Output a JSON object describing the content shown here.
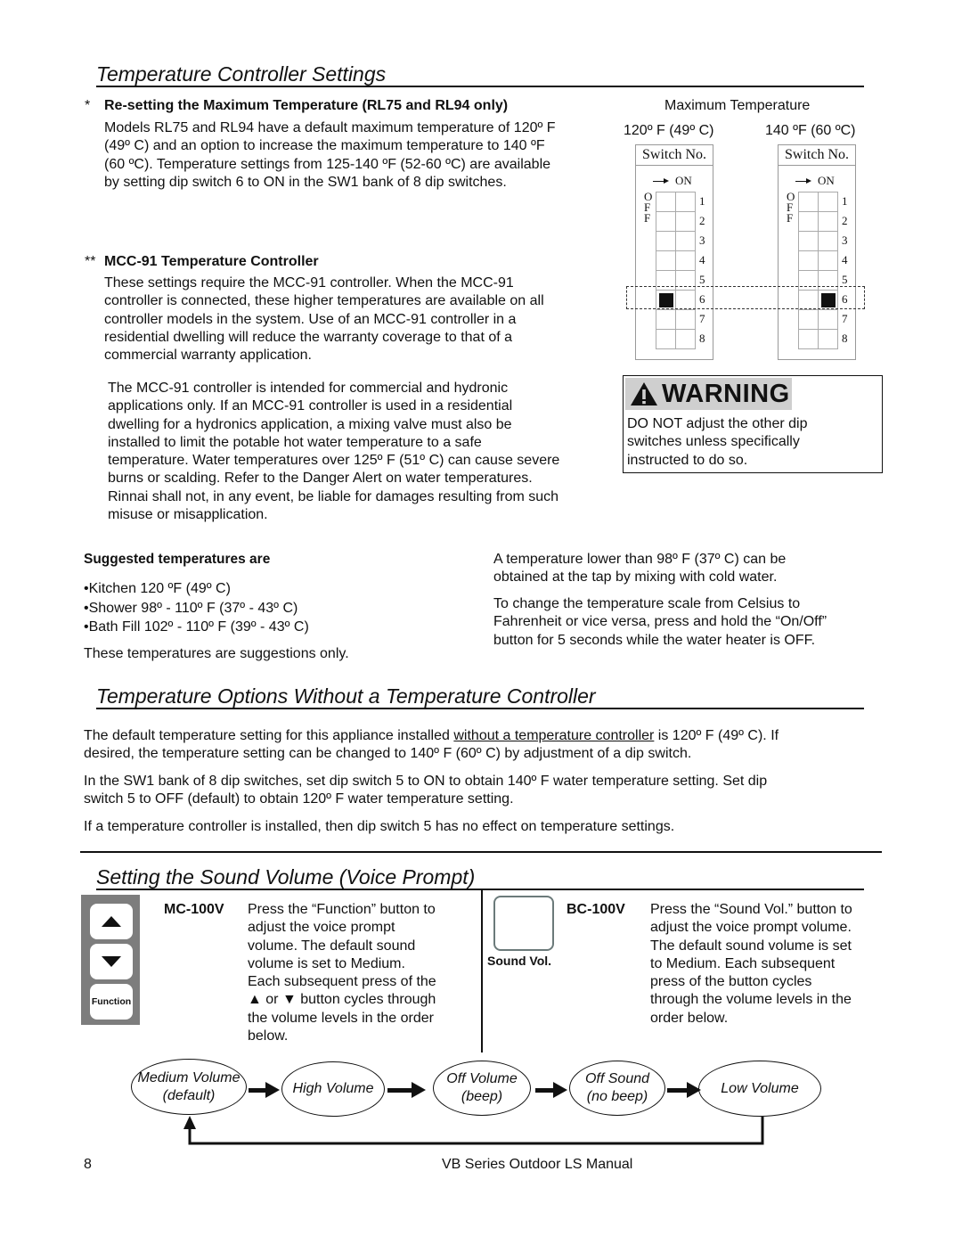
{
  "sections": {
    "controller_settings": {
      "title": "Temperature Controller Settings",
      "reset": {
        "marker": "*",
        "heading": "Re-setting the Maximum Temperature (RL75 and RL94 only)",
        "lines": [
          "Models RL75 and RL94 have a default maximum temperature of 120º F",
          "(49º C) and an option to increase the maximum temperature to 140 ºF",
          "(60 ºC).  Temperature settings from 125-140 ºF (52-60 ºC) are available",
          "by setting dip switch 6 to ON in the SW1 bank of 8 dip switches."
        ]
      },
      "mcc91": {
        "marker": "**",
        "heading": "MCC-91 Temperature Controller",
        "lines": [
          "These settings require the MCC-91 controller.  When the MCC-91",
          "controller is connected, these higher temperatures are available on all",
          "controller models in the system. Use of an MCC-91 controller in a",
          "residential dwelling will reduce the warranty coverage to that of a",
          "commercial warranty application."
        ],
        "note_lines": [
          "The MCC-91 controller is intended for commercial and hydronic",
          "applications only. If an MCC-91 controller is used in a residential",
          "dwelling for a hydronics application, a mixing valve must also be",
          "installed to limit the potable hot water temperature to a safe",
          "temperature. Water temperatures over 125º F (51º C) can cause severe",
          "burns or scalding. Refer to the Danger Alert on water temperatures.",
          "Rinnai shall not, in any event, be liable for damages resulting from such",
          "misuse or misapplication."
        ]
      },
      "dip_diagram": {
        "title": "Maximum Temperature",
        "panels": [
          {
            "temp": "120º F (49º C)",
            "header": "Switch No.",
            "on_label": "ON",
            "off_label": [
              "O",
              "F",
              "F"
            ],
            "switch6_state": "OFF"
          },
          {
            "temp": "140 ºF (60 ºC)",
            "header": "Switch No.",
            "on_label": "ON",
            "off_label": [
              "O",
              "F",
              "F"
            ],
            "switch6_state": "ON"
          }
        ],
        "switch_numbers": [
          "1",
          "2",
          "3",
          "4",
          "5",
          "6",
          "7",
          "8"
        ]
      },
      "warning": {
        "icon": "warning-triangle-icon",
        "title": "WARNING",
        "lines": [
          "DO NOT adjust the other dip",
          "switches unless specifically",
          "instructed to do so."
        ]
      },
      "suggested": {
        "heading": "Suggested temperatures are",
        "items": [
          "•Kitchen  120 ºF (49º C)",
          "•Shower  98º - 110º F (37º - 43º C)",
          "•Bath Fill 102º - 110º F (39º - 43º C)"
        ],
        "footer": "These temperatures are suggestions only."
      },
      "right_notes": {
        "p1": [
          "A temperature lower than 98º F (37º C) can be",
          "obtained at the tap by mixing with cold water."
        ],
        "p2": [
          "To change the temperature scale from Celsius to",
          "Fahrenheit or vice versa, press and hold the “On/Off”",
          "button for 5 seconds while the water heater is OFF."
        ]
      }
    },
    "no_controller": {
      "title": "Temperature Options Without a Temperature Controller",
      "p1_pre": "The default temperature setting for this appliance installed ",
      "p1_link": "without a temperature controller",
      "p1_post": " is 120º F (49º C).  If",
      "p1_line2": "desired, the temperature setting can be changed to 140º F (60º C) by adjustment of a dip switch.",
      "p2": [
        "In the SW1 bank of 8 dip switches, set dip switch 5 to ON to obtain 140º F water temperature setting.  Set dip",
        "switch 5 to OFF (default) to obtain 120º F water temperature setting."
      ],
      "p3": "If a temperature controller is installed, then dip switch 5 has no effect on temperature settings."
    },
    "sound_volume": {
      "title": "Setting the Sound Volume (Voice Prompt)",
      "mc100v": {
        "model": "MC-100V",
        "function_label": "Function",
        "lines": [
          "Press the “Function” button to",
          "adjust the voice prompt",
          "volume.  The default sound",
          "volume is set to Medium.",
          "Each subsequent press of the",
          "▲ or ▼ button cycles through",
          "the volume levels in the order",
          "below."
        ]
      },
      "bc100v": {
        "model": "BC-100V",
        "button_label": "Sound Vol.",
        "lines": [
          "Press the “Sound Vol.” button to",
          "adjust the voice prompt volume.",
          "The default sound volume is set",
          "to Medium.  Each subsequent",
          "press of the button cycles",
          "through the volume levels in the",
          "order below."
        ]
      },
      "cycle": [
        {
          "line1": "Medium Volume",
          "line2": "(default)"
        },
        {
          "line1": "High Volume",
          "line2": ""
        },
        {
          "line1": "Off Volume",
          "line2": "(beep)"
        },
        {
          "line1": "Off Sound",
          "line2": "(no beep)"
        },
        {
          "line1": "Low Volume",
          "line2": ""
        }
      ]
    }
  },
  "footer": {
    "page_number": "8",
    "manual_title": "VB Series Outdoor LS Manual"
  }
}
